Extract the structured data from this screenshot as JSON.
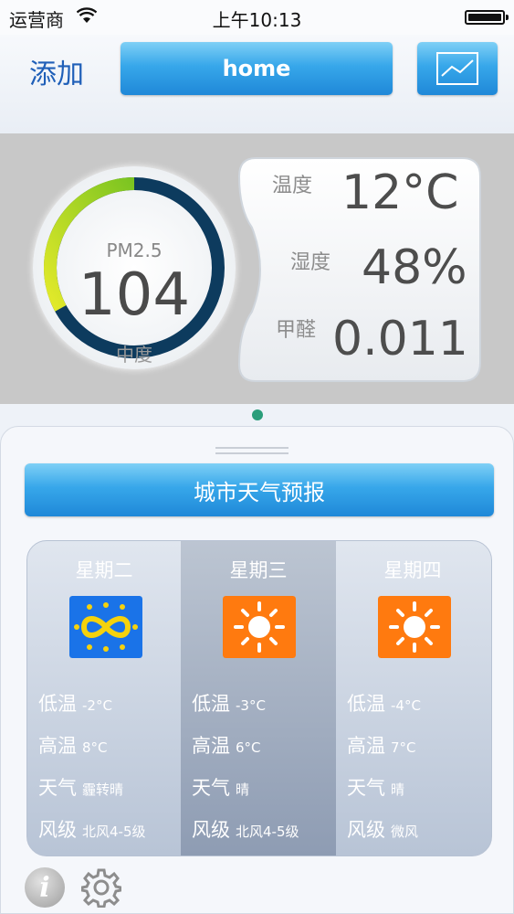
{
  "status_bar": {
    "carrier": "运营商",
    "time": "上午10:13"
  },
  "nav": {
    "add_label": "添加",
    "location_label": "home"
  },
  "air": {
    "pm_label": "PM2.5",
    "pm_value": "104",
    "pm_level": "中度",
    "pm_fraction": 0.33,
    "readings": [
      {
        "label": "温度",
        "value": "12°C"
      },
      {
        "label": "湿度",
        "value": "48%"
      },
      {
        "label": "甲醛",
        "value": "0.011"
      }
    ]
  },
  "forecast": {
    "title": "城市天气预报",
    "row_labels": {
      "low": "低温",
      "high": "高温",
      "weather": "天气",
      "wind": "风级"
    },
    "days": [
      {
        "name": "星期二",
        "icon": "haze-icon",
        "low": "-2°C",
        "high": "8°C",
        "weather": "霾转晴",
        "wind": "北风4-5级"
      },
      {
        "name": "星期三",
        "icon": "sun-icon",
        "low": "-3°C",
        "high": "6°C",
        "weather": "晴",
        "wind": "北风4-5级"
      },
      {
        "name": "星期四",
        "icon": "sun-icon",
        "low": "-4°C",
        "high": "7°C",
        "weather": "晴",
        "wind": "微风"
      }
    ]
  },
  "colors": {
    "accent_blue": "#1f88d8",
    "ring_dark": "#0d3b5e",
    "ring_green": "#7bc421",
    "ring_yellow": "#e4ea2a",
    "sun_orange": "#ff7a0f",
    "haze_blue": "#1a73e8"
  }
}
